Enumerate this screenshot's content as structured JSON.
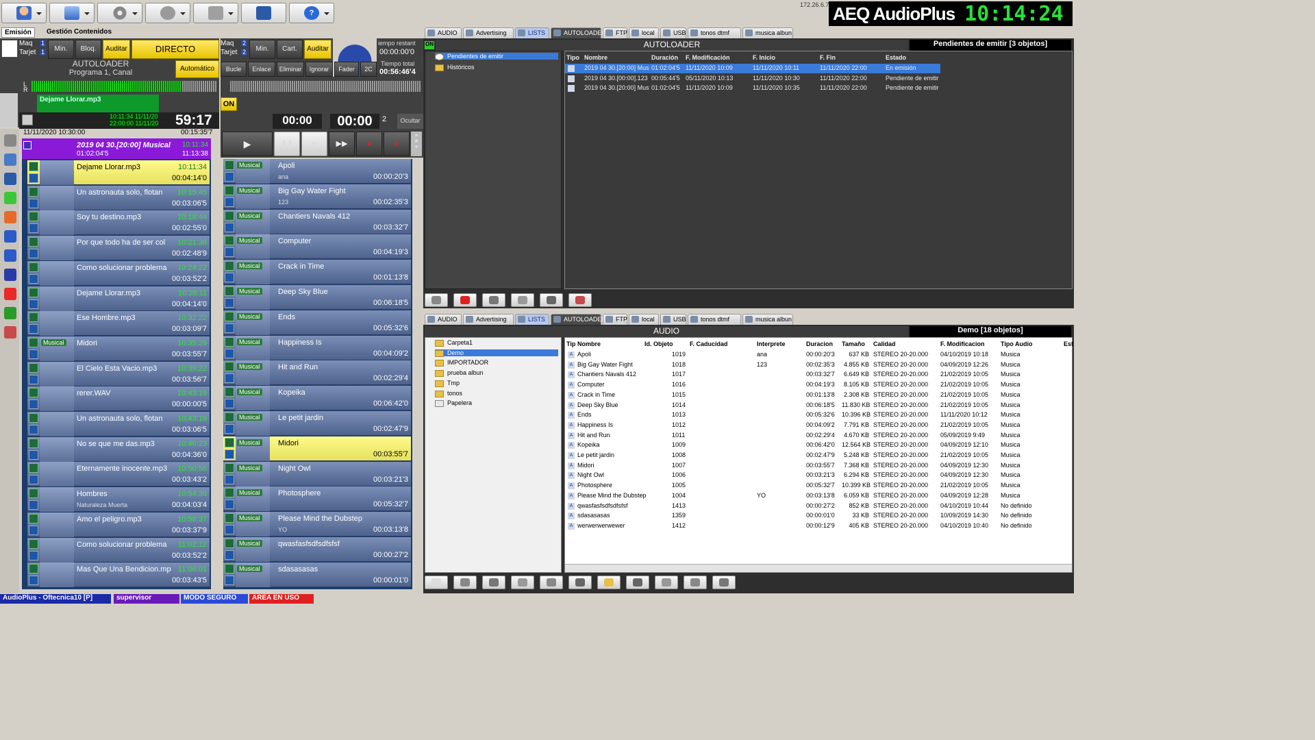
{
  "ip": "172.26.6.7",
  "brand": {
    "name": "AEQ AudioPlus",
    "clock": "10:14:24"
  },
  "left_tabs": [
    "Emisión",
    "Gestión Contenidos"
  ],
  "player1": {
    "maq": "Maq",
    "tarjeta": "Tarjet",
    "n1": "1",
    "n2": "1",
    "btn_min": "Min.",
    "btn_bloq": "Bloq.",
    "btn_auditar": "Auditar",
    "mode": "DIRECTO",
    "loader": "AUTOLOADER",
    "program": "Programa 1, Canal",
    "btn_auto": "Automático",
    "track": "Dejame Llorar.mp3",
    "t_start": "10:11:34 11/11/20",
    "t_end": "22:00:00 11/11/20",
    "remaining": "59:17",
    "date": "11/11/2020 10:30:00",
    "elapsed": "00:15:35'7"
  },
  "player2": {
    "maq": "Maq",
    "tarjeta": "Tarjet",
    "n1": "2",
    "n2": "2",
    "btn_min": "Min.",
    "btn_cart": "Cart.",
    "btn_auditar": "Auditar",
    "tiempo_label": "iempo restant",
    "tiempo": "00:00:00'0",
    "tiempo_total_label": "Tiempo total",
    "tiempo_total": "00:56:46'4",
    "btns": [
      "Bucle",
      "Enlace",
      "Eliminar",
      "Ignorar",
      "Fader",
      "2C"
    ],
    "on": "ON",
    "t1": "00:00",
    "t2": "00:00",
    "count": "2",
    "ocultar": "Ocultar"
  },
  "playlist_header": {
    "title": "2019 04 30.[20:00] Musical",
    "dur": "01:02:04'5",
    "t1": "10:11:34",
    "t2": "11:13:38"
  },
  "playlist_left": [
    {
      "t": "Dejame Llorar.mp3",
      "time": "10:11:34",
      "dur": "00:04:14'0",
      "cur": true
    },
    {
      "t": "Un astronauta solo, flotan",
      "time": "10:15:45",
      "dur": "00:03:06'5"
    },
    {
      "t": "Soy tu destino.mp3",
      "time": "10:18:44",
      "dur": "00:02:55'0"
    },
    {
      "t": "Por que todo ha de ser col",
      "time": "10:21:36",
      "dur": "00:02:48'9"
    },
    {
      "t": "Como solucionar problema",
      "time": "10:24:22",
      "dur": "00:03:52'2"
    },
    {
      "t": "Dejame Llorar.mp3",
      "time": "10:28:11",
      "dur": "00:04:14'0"
    },
    {
      "t": "Ese Hombre.mp3",
      "time": "10:32:22",
      "dur": "00:03:09'7"
    },
    {
      "t": "Midori",
      "time": "10:35:29",
      "dur": "00:03:55'7",
      "tag": "Musical"
    },
    {
      "t": "El Cielo Esta Vacio.mp3",
      "time": "10:39:22",
      "dur": "00:03:56'7"
    },
    {
      "t": "rerer.WAV",
      "time": "10:43:19",
      "dur": "00:00:00'5"
    },
    {
      "t": "Un astronauta solo, flotan",
      "time": "10:43:19",
      "dur": "00:03:06'5"
    },
    {
      "t": "No se que me das.mp3",
      "time": "10:46:23",
      "dur": "00:04:36'0"
    },
    {
      "t": "Eternamente inocente.mp3",
      "time": "10:50:56",
      "dur": "00:03:43'2"
    },
    {
      "t": "Hombres",
      "time": "10:54:36",
      "dur": "00:04:03'4",
      "sub": "Naturaleza Muerta"
    },
    {
      "t": "Amo el peligro.mp3",
      "time": "10:58:37",
      "dur": "00:03:37'9"
    },
    {
      "t": "Como solucionar problema",
      "time": "11:02:12",
      "dur": "00:03:52'2"
    },
    {
      "t": "Mas Que Una Bendicion.mp",
      "time": "11:06:01",
      "dur": "00:03:43'5"
    }
  ],
  "playlist_mid": [
    {
      "t": "Apoli",
      "sub": "ana",
      "dur": "00:00:20'3"
    },
    {
      "t": "Big Gay Water Fight",
      "sub": "123",
      "dur": "00:02:35'3"
    },
    {
      "t": "Chantiers Navals 412",
      "dur": "00:03:32'7"
    },
    {
      "t": "Computer",
      "dur": "00:04:19'3"
    },
    {
      "t": "Crack in Time",
      "dur": "00:01:13'8"
    },
    {
      "t": "Deep Sky Blue",
      "dur": "00:06:18'5"
    },
    {
      "t": "Ends",
      "dur": "00:05:32'6"
    },
    {
      "t": "Happiness Is",
      "dur": "00:04:09'2"
    },
    {
      "t": "Hit and Run",
      "dur": "00:02:29'4"
    },
    {
      "t": "Kopeika",
      "dur": "00:06:42'0"
    },
    {
      "t": "Le petit jardin",
      "dur": "00:02:47'9"
    },
    {
      "t": "Midori",
      "dur": "00:03:55'7",
      "cur": true
    },
    {
      "t": "Night Owl",
      "dur": "00:03:21'3"
    },
    {
      "t": "Photosphere",
      "dur": "00:05:32'7"
    },
    {
      "t": "Please Mind the Dubstep",
      "sub": "YO",
      "dur": "00:03:13'8"
    },
    {
      "t": "qwasfasfsdfsdfsfsf",
      "dur": "00:00:27'2"
    },
    {
      "t": "sdasasasas",
      "dur": "00:00:01'0"
    }
  ],
  "tag_musical": "Musical",
  "right_tabs": [
    "AUDIO",
    "Advertising",
    "LISTS",
    "AUTOLOADER",
    "FTP",
    "local",
    "USB",
    "tonos dtmf",
    "musica albun"
  ],
  "autoloader": {
    "on": "ON",
    "title": "AUTOLOADER",
    "status": "Pendientes de emitir [3 objetos]",
    "tree": [
      "Pendientes de emitir",
      "Históricos"
    ],
    "cols": [
      "Tipo",
      "Nombre",
      "Duración",
      "F. Modificación",
      "F. Inicio",
      "F. Fin",
      "Estado"
    ],
    "rows": [
      [
        "2019 04 30.[20:00] Mus",
        "01:02:04'5",
        "11/11/2020 10:09",
        "11/11/2020 10:11",
        "11/11/2020 22:00",
        "En emisión"
      ],
      [
        "2019 04 30.[00:00].123",
        "00:05:44'5",
        "05/11/2020 10:13",
        "11/11/2020 10:30",
        "11/11/2020 22:00",
        "Pendiente de emitir"
      ],
      [
        "2019 04 30.[20:00] Mus",
        "01:02:04'5",
        "11/11/2020 10:09",
        "11/11/2020 10:35",
        "11/11/2020 22:00",
        "Pendiente de emitir"
      ]
    ]
  },
  "audio": {
    "title": "AUDIO",
    "status": "Demo [18 objetos]",
    "tree": [
      "Carpeta1",
      "Demo",
      "IMPORTADOR",
      "prueba albun",
      "Tmp",
      "tonos",
      "Papelera"
    ],
    "cols": [
      "Tip",
      "Nombre",
      "Id. Objeto",
      "F. Caducidad",
      "Interprete",
      "Duracion",
      "Tamaño",
      "Calidad",
      "F. Modificacion",
      "Tipo Audio",
      "Est"
    ],
    "rows": [
      [
        "Apoli",
        "1019",
        "ana",
        "00:00:20'3",
        "637 KB",
        "STEREO 20-20.000",
        "04/10/2019 10:18",
        "Musica"
      ],
      [
        "Big Gay Water Fight",
        "1018",
        "123",
        "00:02:35'3",
        "4.855 KB",
        "STEREO 20-20.000",
        "04/09/2019 12:26",
        "Musica"
      ],
      [
        "Chantiers Navals 412",
        "1017",
        "",
        "00:03:32'7",
        "6.649 KB",
        "STEREO 20-20.000",
        "21/02/2019 10:05",
        "Musica"
      ],
      [
        "Computer",
        "1016",
        "",
        "00:04:19'3",
        "8.105 KB",
        "STEREO 20-20.000",
        "21/02/2019 10:05",
        "Musica"
      ],
      [
        "Crack in Time",
        "1015",
        "",
        "00:01:13'8",
        "2.308 KB",
        "STEREO 20-20.000",
        "21/02/2019 10:05",
        "Musica"
      ],
      [
        "Deep Sky Blue",
        "1014",
        "",
        "00:06:18'5",
        "11.830 KB",
        "STEREO 20-20.000",
        "21/02/2019 10:05",
        "Musica"
      ],
      [
        "Ends",
        "1013",
        "",
        "00:05:32'6",
        "10.396 KB",
        "STEREO 20-20.000",
        "11/11/2020 10:12",
        "Musica"
      ],
      [
        "Happiness Is",
        "1012",
        "",
        "00:04:09'2",
        "7.791 KB",
        "STEREO 20-20.000",
        "21/02/2019 10:05",
        "Musica"
      ],
      [
        "Hit and Run",
        "1011",
        "",
        "00:02:29'4",
        "4.670 KB",
        "STEREO 20-20.000",
        "05/09/2019 9:49",
        "Musica"
      ],
      [
        "Kopeika",
        "1009",
        "",
        "00:06:42'0",
        "12.564 KB",
        "STEREO 20-20.000",
        "04/09/2019 12:10",
        "Musica"
      ],
      [
        "Le petit jardin",
        "1008",
        "",
        "00:02:47'9",
        "5.248 KB",
        "STEREO 20-20.000",
        "21/02/2019 10:05",
        "Musica"
      ],
      [
        "Midori",
        "1007",
        "",
        "00:03:55'7",
        "7.368 KB",
        "STEREO 20-20.000",
        "04/09/2019 12:30",
        "Musica"
      ],
      [
        "Night Owl",
        "1006",
        "",
        "00:03:21'3",
        "6.294 KB",
        "STEREO 20-20.000",
        "04/09/2019 12:30",
        "Musica"
      ],
      [
        "Photosphere",
        "1005",
        "",
        "00:05:32'7",
        "10.399 KB",
        "STEREO 20-20.000",
        "21/02/2019 10:05",
        "Musica"
      ],
      [
        "Please Mind the Dubstep",
        "1004",
        "YO",
        "00:03:13'8",
        "6.059 KB",
        "STEREO 20-20.000",
        "04/09/2019 12:28",
        "Musica"
      ],
      [
        "qwasfasfsdfsdfsfsf",
        "1413",
        "",
        "00:00:27'2",
        "852 KB",
        "STEREO 20-20.000",
        "04/10/2019 10:44",
        "No definido"
      ],
      [
        "sdasasasas",
        "1359",
        "",
        "00:00:01'0",
        "33 KB",
        "STEREO 20-20.000",
        "10/09/2019 14:30",
        "No definido"
      ],
      [
        "werwerwerwewer",
        "1412",
        "",
        "00:00:12'9",
        "405 KB",
        "STEREO 20-20.000",
        "04/10/2019 10:40",
        "No definido"
      ]
    ]
  },
  "statusbar": [
    "AudioPlus - Oftecnica10 [P]",
    "supervisor",
    "MODO SEGURO",
    "AREA EN USO"
  ]
}
